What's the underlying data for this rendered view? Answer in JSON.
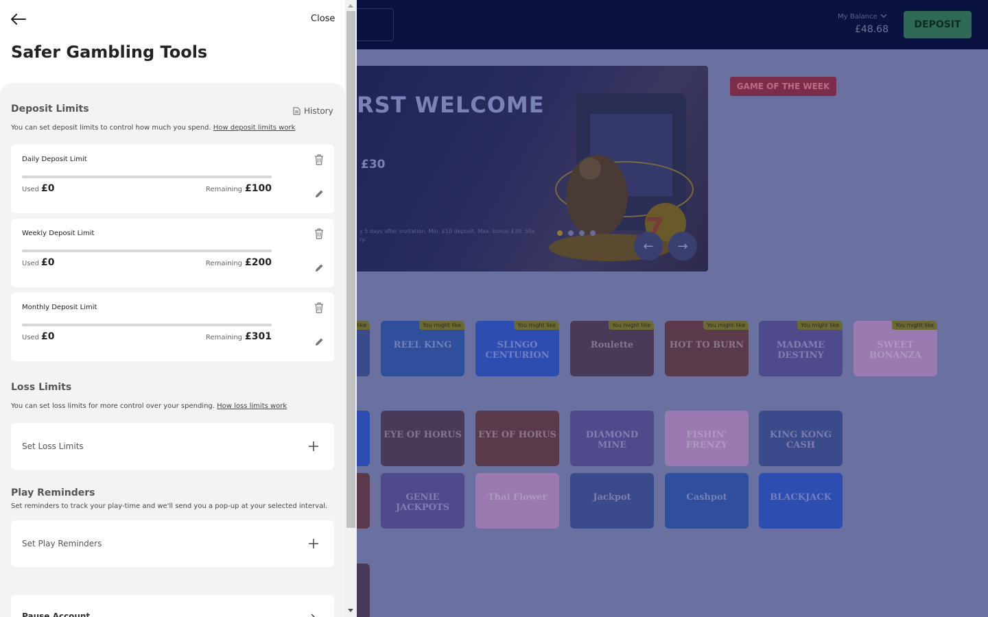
{
  "drawer": {
    "title": "Safer Gambling Tools",
    "close_label": "Close",
    "deposit_limits": {
      "title": "Deposit Limits",
      "history_label": "History",
      "description": "You can set deposit limits to control how much you spend.",
      "link": "How deposit limits work",
      "used_label": "Used",
      "remaining_label": "Remaining",
      "cards": [
        {
          "title": "Daily Deposit Limit",
          "used": "£0",
          "remaining": "£100",
          "progress": 0
        },
        {
          "title": "Weekly Deposit Limit",
          "used": "£0",
          "remaining": "£200",
          "progress": 0
        },
        {
          "title": "Monthly Deposit Limit",
          "used": "£0",
          "remaining": "£301",
          "progress": 0
        }
      ]
    },
    "loss_limits": {
      "title": "Loss Limits",
      "description": "You can set loss limits for more control over your spending.",
      "link": "How loss limits work",
      "action": "Set Loss Limits"
    },
    "play_reminders": {
      "title": "Play Reminders",
      "description": "Set reminders to track your play-time and we'll send you a pop-up at your selected interval.",
      "action": "Set Play Reminders"
    },
    "pause_account": {
      "action": "Pause Account"
    }
  },
  "site": {
    "balance_label": "My Balance",
    "balance_value": "£48.68",
    "deposit_label": "DEPOSIT",
    "banner_title": "RST WELCOME",
    "banner_amount": "£30",
    "banner_fine_print": "y 5 days after invitation. Min. £10 deposit. Max. bonus £30. 50x ry.",
    "game_of_week": "GAME OF THE WEEK",
    "tile_tag": "You might like",
    "row1": [
      "",
      "REEL KING",
      "SLINGO CENTURION",
      "Roulette",
      "HOT TO BURN",
      "MADAME DESTINY",
      "SWEET BONANZA"
    ],
    "row2": [
      "",
      "EYE OF HORUS",
      "EYE OF HORUS",
      "DIAMOND MINE",
      "FISHIN' FRENZY",
      "KING KONG CASH"
    ],
    "row3": [
      "",
      "GENIE JACKPOTS",
      "Thai Flower",
      "Jackpot",
      "Cashpot",
      "BLACKJACK"
    ]
  },
  "colors": {
    "overlay": "#6a70a0",
    "header": "#0a1240",
    "deposit_button": "#2e6a55",
    "drawer_bg": "#ffffff",
    "panel_bg": "#f3f3f3"
  }
}
